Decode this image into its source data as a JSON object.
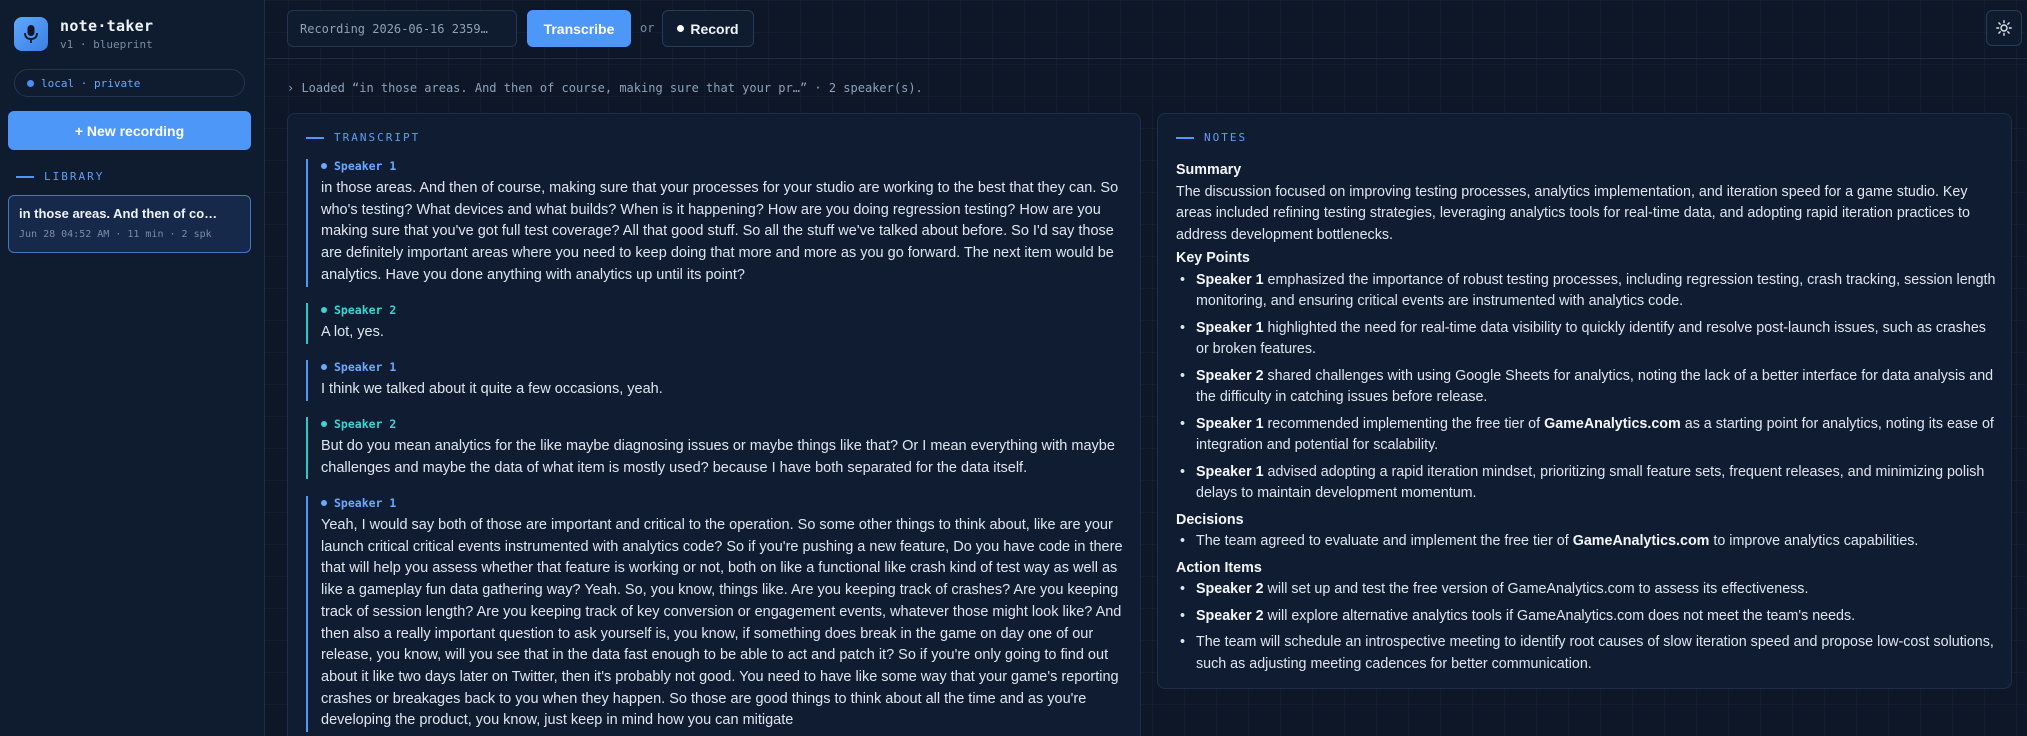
{
  "brand": {
    "name": "note·taker",
    "sub": "v1 · blueprint"
  },
  "sidebar": {
    "privacy_badge": "local · private",
    "new_recording": "+ New recording",
    "library_label": "LIBRARY",
    "library_items": [
      {
        "title": "in those areas. And then of co…",
        "meta": "Jun 28 04:52 AM · 11 min · 2 spk"
      }
    ]
  },
  "toolbar": {
    "recording_name": "Recording 2026-06-16 2359…",
    "transcribe_label": "Transcribe",
    "or_label": "or",
    "record_label": "Record",
    "theme_icon": "sun-icon"
  },
  "status": "› Loaded “in those areas. And then of course, making sure that your pr…” · 2 speaker(s).",
  "transcript": {
    "label": "TRANSCRIPT",
    "turns": [
      {
        "speaker": "Speaker 1",
        "text": "in those areas. And then of course, making sure that your processes for your studio are working to the best that they can. So who's testing? What devices and what builds? When is it happening? How are you doing regression testing? How are you making sure that you've got full test coverage? All that good stuff. So all the stuff we've talked about before. So I'd say those are definitely important areas where you need to keep doing that more and more as you go forward. The next item would be analytics. Have you done anything with analytics up until its point?"
      },
      {
        "speaker": "Speaker 2",
        "text": "A lot, yes."
      },
      {
        "speaker": "Speaker 1",
        "text": "I think we talked about it quite a few occasions, yeah."
      },
      {
        "speaker": "Speaker 2",
        "text": "But do you mean analytics for the like maybe diagnosing issues or maybe things like that? Or I mean everything with maybe challenges and maybe the data of what item is mostly used? because I have both separated for the data itself."
      },
      {
        "speaker": "Speaker 1",
        "text": "Yeah, I would say both of those are important and critical to the operation. So some other things to think about, like are your launch critical critical events instrumented with analytics code? So if you're pushing a new feature, Do you have code in there that will help you assess whether that feature is working or not, both on like a functional like crash kind of test way as well as like a gameplay fun data gathering way? Yeah. So, you know, things like. Are you keeping track of crashes? Are you keeping track of session length? Are you keeping track of key conversion or engagement events, whatever those might look like? And then also a really important question to ask yourself is, you know, if something does break in the game on day one of our release, you know, will you see that in the data fast enough to be able to act and patch it? So if you're only going to find out about it like two days later on Twitter, then it's probably not good. You need to have like some way that your game's reporting crashes or breakages back to you when they happen. So those are good things to think about all the time and as you're developing the product, you know, just keep in mind how you can mitigate"
      }
    ]
  },
  "notes": {
    "label": "NOTES",
    "summary_heading": "Summary",
    "summary": "The discussion focused on improving testing processes, analytics implementation, and iteration speed for a game studio. Key areas included refining testing strategies, leveraging analytics tools for real-time data, and adopting rapid iteration practices to address development bottlenecks.",
    "key_points_heading": "Key Points",
    "key_points": [
      {
        "speaker": "Speaker 1",
        "text": " emphasized the importance of robust testing processes, including regression testing, crash tracking, session length monitoring, and ensuring critical events are instrumented with analytics code."
      },
      {
        "speaker": "Speaker 1",
        "text": " highlighted the need for real-time data visibility to quickly identify and resolve post-launch issues, such as crashes or broken features."
      },
      {
        "speaker": "Speaker 2",
        "text": " shared challenges with using Google Sheets for analytics, noting the lack of a better interface for data analysis and the difficulty in catching issues before release."
      },
      {
        "speaker": "Speaker 1",
        "text_before": " recommended implementing the free tier of ",
        "bold": "GameAnalytics.com",
        "text_after": " as a starting point for analytics, noting its ease of integration and potential for scalability."
      },
      {
        "speaker": "Speaker 1",
        "text": " advised adopting a rapid iteration mindset, prioritizing small feature sets, frequent releases, and minimizing polish delays to maintain development momentum."
      }
    ],
    "decisions_heading": "Decisions",
    "decisions": [
      {
        "text_before": "The team agreed to evaluate and implement the free tier of ",
        "bold": "GameAnalytics.com",
        "text_after": " to improve analytics capabilities."
      }
    ],
    "actions_heading": "Action Items",
    "actions": [
      {
        "speaker": "Speaker 2",
        "text": " will set up and test the free version of GameAnalytics.com to assess its effectiveness."
      },
      {
        "speaker": "Speaker 2",
        "text": " will explore alternative analytics tools if GameAnalytics.com does not meet the team's needs."
      },
      {
        "text": "The team will schedule an introspective meeting to identify root causes of slow iteration speed and propose low-cost solutions, such as adjusting meeting cadences for better communication."
      }
    ]
  }
}
